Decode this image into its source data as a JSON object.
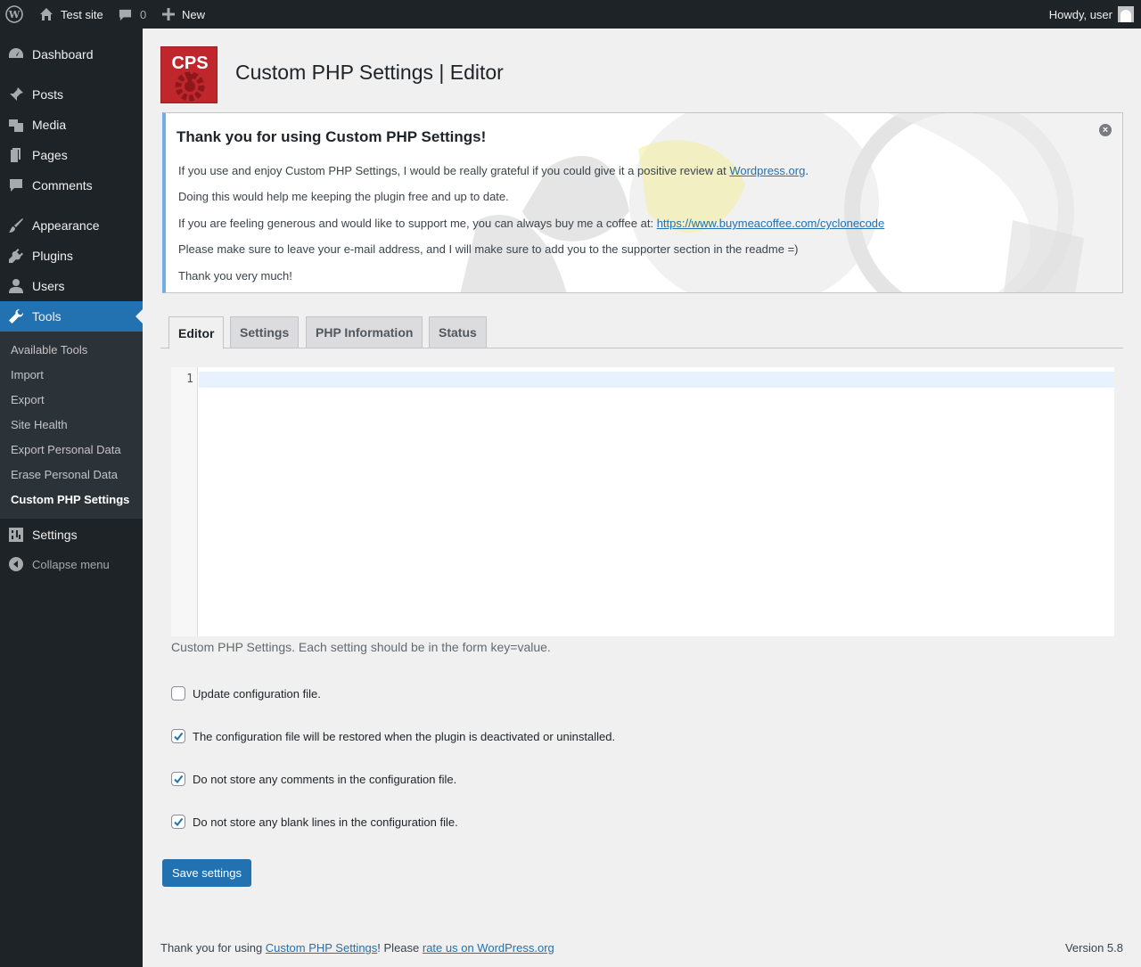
{
  "adminbar": {
    "site_name": "Test site",
    "comments_count": "0",
    "new_label": "New",
    "greeting": "Howdy, user"
  },
  "sidebar": {
    "items": [
      {
        "label": "Dashboard",
        "icon": "dashboard-icon"
      },
      {
        "label": "Posts",
        "icon": "pushpin-icon"
      },
      {
        "label": "Media",
        "icon": "media-icon"
      },
      {
        "label": "Pages",
        "icon": "pages-icon"
      },
      {
        "label": "Comments",
        "icon": "comment-icon"
      },
      {
        "label": "Appearance",
        "icon": "paintbrush-icon"
      },
      {
        "label": "Plugins",
        "icon": "plug-icon"
      },
      {
        "label": "Users",
        "icon": "user-icon"
      },
      {
        "label": "Tools",
        "icon": "wrench-icon"
      },
      {
        "label": "Settings",
        "icon": "sliders-icon"
      }
    ],
    "submenu": [
      "Available Tools",
      "Import",
      "Export",
      "Site Health",
      "Export Personal Data",
      "Erase Personal Data",
      "Custom PHP Settings"
    ],
    "collapse_label": "Collapse menu"
  },
  "page": {
    "logo_text": "CPS",
    "title": "Custom PHP Settings | Editor"
  },
  "notice": {
    "heading": "Thank you for using Custom PHP Settings!",
    "line1_prefix": "If you use and enjoy Custom PHP Settings, I would be really grateful if you could give it a positive review at ",
    "line1_link": "Wordpress.org",
    "line1_suffix": ".",
    "line2": "Doing this would help me keeping the plugin free and up to date.",
    "line3_prefix": "If you are feeling generous and would like to support me, you can always buy me a coffee at: ",
    "line3_link": "https://www.buymeacoffee.com/cyclonecode",
    "line4": "Please make sure to leave your e-mail address, and I will make sure to add you to the supporter section in the readme =)",
    "line5": "Thank you very much!"
  },
  "tabs": [
    "Editor",
    "Settings",
    "PHP Information",
    "Status"
  ],
  "editor": {
    "line_number": "1",
    "description": "Custom PHP Settings. Each setting should be in the form key=value."
  },
  "options": [
    {
      "label": "Update configuration file.",
      "checked": false
    },
    {
      "label": "The configuration file will be restored when the plugin is deactivated or uninstalled.",
      "checked": true
    },
    {
      "label": "Do not store any comments in the configuration file.",
      "checked": true
    },
    {
      "label": "Do not store any blank lines in the configuration file.",
      "checked": true
    }
  ],
  "save_label": "Save settings",
  "footer": {
    "prefix": "Thank you for using ",
    "plugin_link": "Custom PHP Settings",
    "middle": "! Please ",
    "rate_link": "rate us on WordPress.org",
    "version": "Version 5.8"
  },
  "colors": {
    "adminbar": "#1d2327",
    "accent": "#2271b1",
    "logo": "#c0272d"
  }
}
